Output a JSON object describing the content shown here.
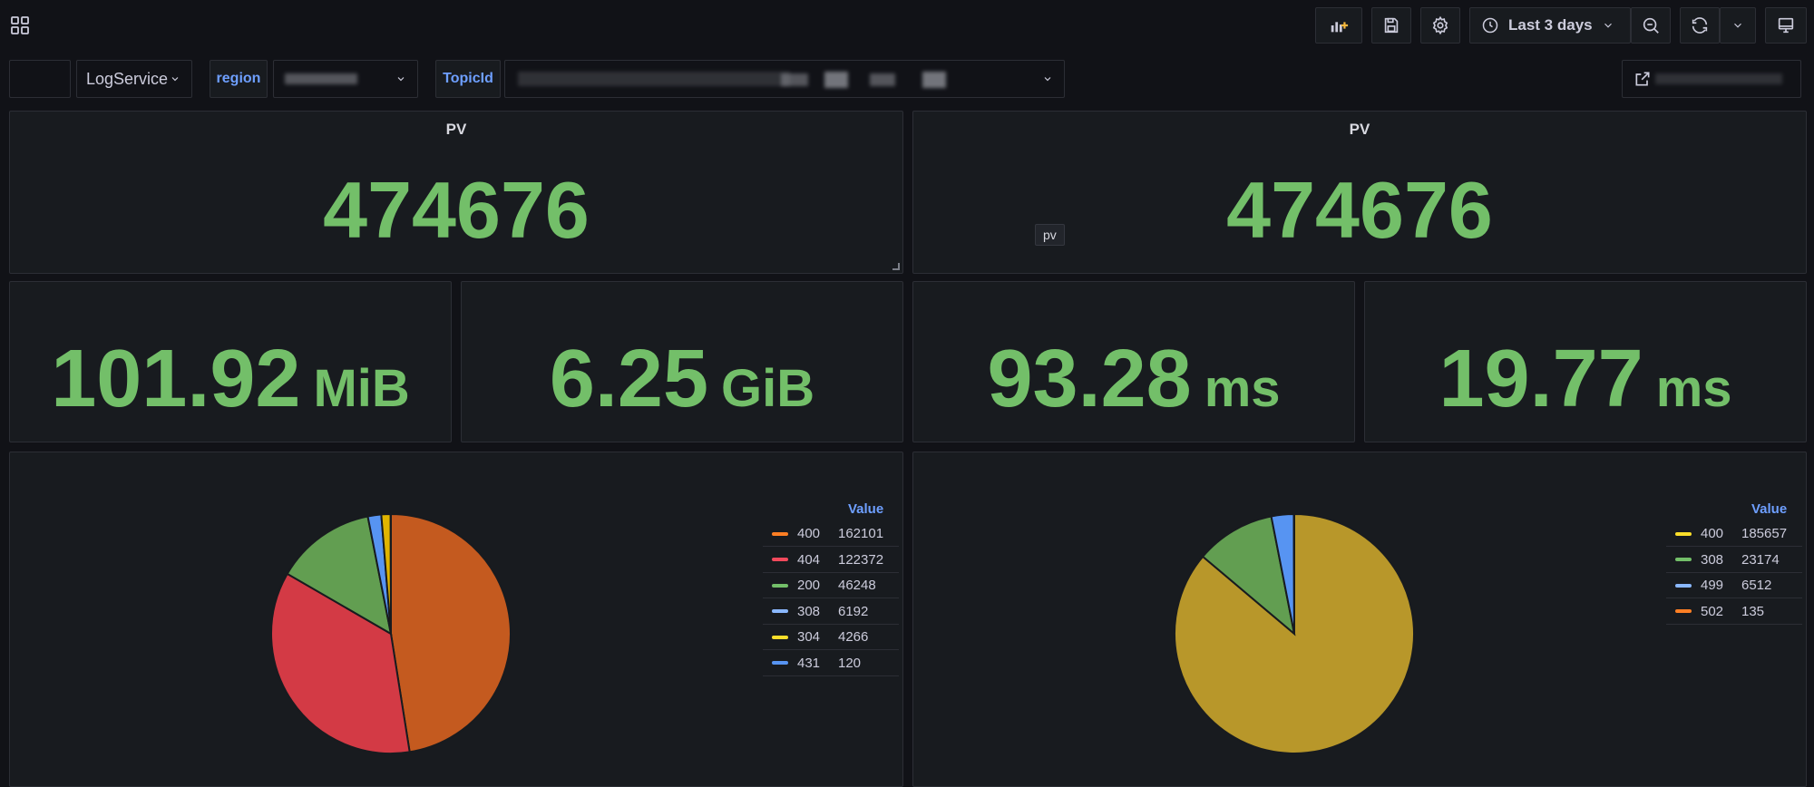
{
  "toolbar": {
    "time_range": "Last 3 days"
  },
  "variables": {
    "datasource_value": "LogService",
    "region_label": "region",
    "topic_label": "TopicId"
  },
  "panels": {
    "pv_left": {
      "title": "PV",
      "value": "474676"
    },
    "pv_right": {
      "title": "PV",
      "value": "474676",
      "tooltip": "pv"
    },
    "stat1": {
      "value": "101.92",
      "unit": "MiB"
    },
    "stat2": {
      "value": "6.25",
      "unit": "GiB"
    },
    "stat3": {
      "value": "93.28",
      "unit": "ms"
    },
    "stat4": {
      "value": "19.77",
      "unit": "ms"
    }
  },
  "colors": {
    "stat_green": "#73bf69",
    "accent_blue": "#6e9fff"
  },
  "chart_data": [
    {
      "type": "pie",
      "legend_header": "Value",
      "legend_position": "right",
      "categories": [
        "400",
        "404",
        "200",
        "308",
        "304",
        "431"
      ],
      "values": [
        162101,
        122372,
        46248,
        6192,
        4266,
        120
      ],
      "colors": [
        "#c45a1f",
        "#d33a45",
        "#629e51",
        "#5794f2",
        "#e0b400",
        "#5577ee"
      ],
      "legend_colors": [
        "#ff7f24",
        "#f2495c",
        "#73bf69",
        "#8ab8ff",
        "#fade2a",
        "#5794f2"
      ]
    },
    {
      "type": "pie",
      "legend_header": "Value",
      "legend_position": "right",
      "categories": [
        "400",
        "308",
        "499",
        "502"
      ],
      "values": [
        185657,
        23174,
        6512,
        135
      ],
      "colors": [
        "#b8972a",
        "#629e51",
        "#5794f2",
        "#ff7f24"
      ],
      "legend_colors": [
        "#fade2a",
        "#73bf69",
        "#8ab8ff",
        "#ff7f24"
      ]
    }
  ]
}
